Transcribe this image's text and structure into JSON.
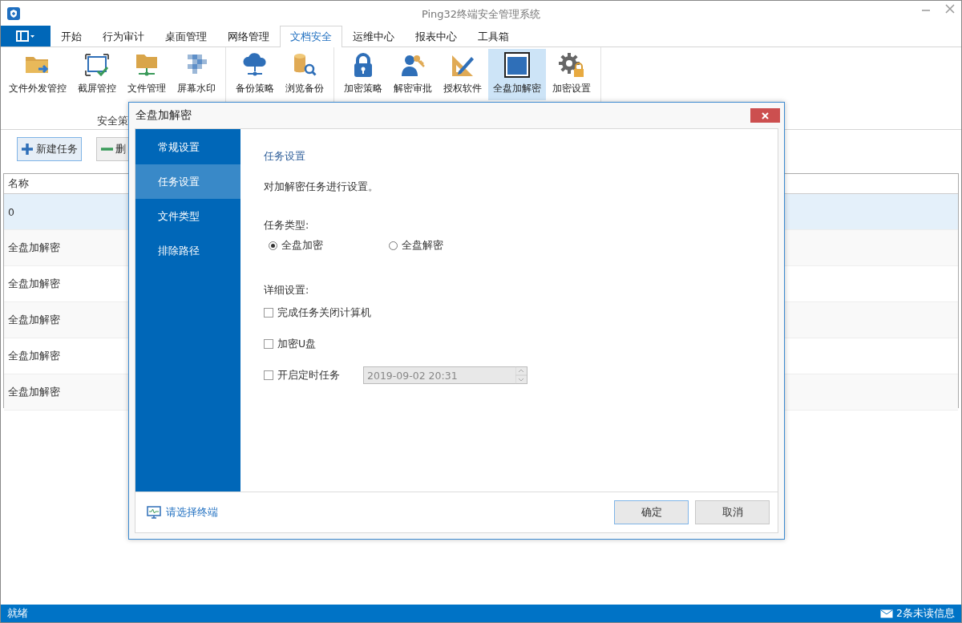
{
  "window": {
    "title": "Ping32终端安全管理系统"
  },
  "tabs": [
    {
      "label": "开始",
      "selected": false
    },
    {
      "label": "行为审计",
      "selected": false
    },
    {
      "label": "桌面管理",
      "selected": false
    },
    {
      "label": "网络管理",
      "selected": false
    },
    {
      "label": "文档安全",
      "selected": true
    },
    {
      "label": "运维中心",
      "selected": false
    },
    {
      "label": "报表中心",
      "selected": false
    },
    {
      "label": "工具箱",
      "selected": false
    }
  ],
  "ribbon": {
    "groups": [
      {
        "label": "安全策",
        "items": [
          {
            "label": "文件外发管控",
            "selected": false
          },
          {
            "label": "截屏管控",
            "selected": false
          },
          {
            "label": "文件管理",
            "selected": false
          },
          {
            "label": "屏幕水印",
            "selected": false
          }
        ]
      },
      {
        "items": [
          {
            "label": "备份策略",
            "selected": false
          },
          {
            "label": "浏览备份",
            "selected": false
          }
        ]
      },
      {
        "items": [
          {
            "label": "加密策略",
            "selected": false
          },
          {
            "label": "解密审批",
            "selected": false
          },
          {
            "label": "授权软件",
            "selected": false
          },
          {
            "label": "全盘加解密",
            "selected": true
          },
          {
            "label": "加密设置",
            "selected": false
          }
        ]
      }
    ]
  },
  "toolbar": [
    {
      "label": "新建任务",
      "kind": "add",
      "focused": true
    },
    {
      "label": "删",
      "kind": "remove",
      "focused": false
    }
  ],
  "table": {
    "columns": [
      "名称"
    ],
    "rows": [
      {
        "cells": [
          "0"
        ],
        "selected": true
      },
      {
        "cells": [
          "全盘加解密"
        ],
        "selected": false
      },
      {
        "cells": [
          "全盘加解密"
        ],
        "selected": false
      },
      {
        "cells": [
          "全盘加解密"
        ],
        "selected": false
      },
      {
        "cells": [
          "全盘加解密"
        ],
        "selected": false
      },
      {
        "cells": [
          "全盘加解密"
        ],
        "selected": false
      }
    ]
  },
  "dialog": {
    "title": "全盘加解密",
    "nav": [
      {
        "label": "常规设置",
        "selected": false
      },
      {
        "label": "任务设置",
        "selected": true
      },
      {
        "label": "文件类型",
        "selected": false
      },
      {
        "label": "排除路径",
        "selected": false
      }
    ],
    "section_title": "任务设置",
    "description": "对加解密任务进行设置。",
    "task_type_label": "任务类型:",
    "task_types": [
      {
        "label": "全盘加密",
        "selected": true
      },
      {
        "label": "全盘解密",
        "selected": false
      }
    ],
    "details_label": "详细设置:",
    "options": [
      {
        "label": "完成任务关闭计算机",
        "checked": false
      },
      {
        "label": "加密U盘",
        "checked": false
      },
      {
        "label": "开启定时任务",
        "checked": false
      }
    ],
    "schedule": {
      "value": "2019-09-02 20:31",
      "disabled": true
    },
    "terminal_link": "请选择终端",
    "buttons": [
      {
        "label": "确定",
        "default": true
      },
      {
        "label": "取消",
        "default": false
      }
    ]
  },
  "status_bar": {
    "left": "就绪",
    "messages": "2条未读信息"
  }
}
